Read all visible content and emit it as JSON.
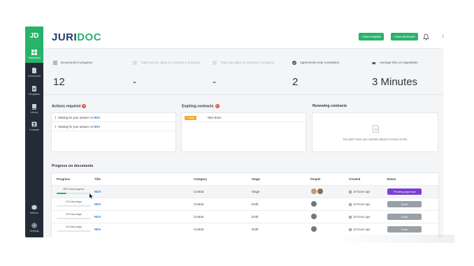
{
  "sidebar": {
    "logo": "JD",
    "items": [
      {
        "label": "Dashboard",
        "icon": "grid-icon"
      },
      {
        "label": "Documents",
        "icon": "document-icon"
      },
      {
        "label": "Templates",
        "icon": "template-icon"
      },
      {
        "label": "Library",
        "icon": "library-icon"
      },
      {
        "label": "Contacts",
        "icon": "contacts-icon"
      },
      {
        "label": "Addons",
        "icon": "addons-icon"
      },
      {
        "label": "Settings",
        "icon": "gear-icon"
      }
    ]
  },
  "header": {
    "brand_a": "JURI",
    "brand_b": "DOC",
    "new_template": "New template",
    "new_document": "New document"
  },
  "stats": [
    {
      "label": "Documents in progress",
      "value": "12",
      "icon": "list-icon"
    },
    {
      "label": "Total revenue value of contracts in progress",
      "value": "-",
      "icon": "money-icon"
    },
    {
      "label": "Total cost value of contracts in progress",
      "value": "-",
      "icon": "money-icon"
    },
    {
      "label": "Agreements near completion",
      "value": "2",
      "icon": "check-circle-icon"
    },
    {
      "label": "Average time on negotiation",
      "value": "3 Minutes",
      "icon": "coffee-icon"
    }
  ],
  "actions": {
    "title": "Actions required",
    "count": "2",
    "rows": [
      {
        "text": "Waiting for your answer on",
        "link": "NDA"
      },
      {
        "text": "Waiting for your answer on",
        "link": "NDA"
      }
    ]
  },
  "expiring": {
    "title": "Expiring contracts",
    "count": "1",
    "rows": [
      {
        "badge": "7 Days",
        "name": "NDA Bruin"
      }
    ]
  },
  "renewing": {
    "title": "Renewing contracts",
    "empty_text": "You don't have any contract about to renew so far."
  },
  "progress": {
    "title": "Progress on documents",
    "headers": [
      "Progress",
      "Title",
      "Category",
      "Stage",
      "People",
      "Created",
      "Status"
    ],
    "rows": [
      {
        "progress_label": "28% Good progress",
        "progress": 0.28,
        "title": "NDA",
        "category": "Contrat",
        "stage": "Stage",
        "people": 2,
        "created": "18 hours ago",
        "status": "Pending Approval",
        "status_color": "#7b3fd0"
      },
      {
        "progress_label": "0% Early stage",
        "progress": 0,
        "title": "NDA",
        "category": "Contrat",
        "stage": "Draft",
        "people": 1,
        "created": "19 hours ago",
        "status": "Draft",
        "status_color": "#9aa0a6"
      },
      {
        "progress_label": "0% Early stage",
        "progress": 0,
        "title": "NDA",
        "category": "Contrat",
        "stage": "Draft",
        "people": 1,
        "created": "19 hours ago",
        "status": "Draft",
        "status_color": "#9aa0a6"
      },
      {
        "progress_label": "0% Early stage",
        "progress": 0,
        "title": "NDA",
        "category": "Contrat",
        "stage": "Draft",
        "people": 1,
        "created": "19 hours ago",
        "status": "Draft",
        "status_color": "#9aa0a6"
      }
    ]
  },
  "colors": {
    "accent": "#27b36a",
    "sidebar": "#222b36",
    "link": "#2c7be5",
    "alert": "#e5533d",
    "warn": "#f5a623"
  }
}
